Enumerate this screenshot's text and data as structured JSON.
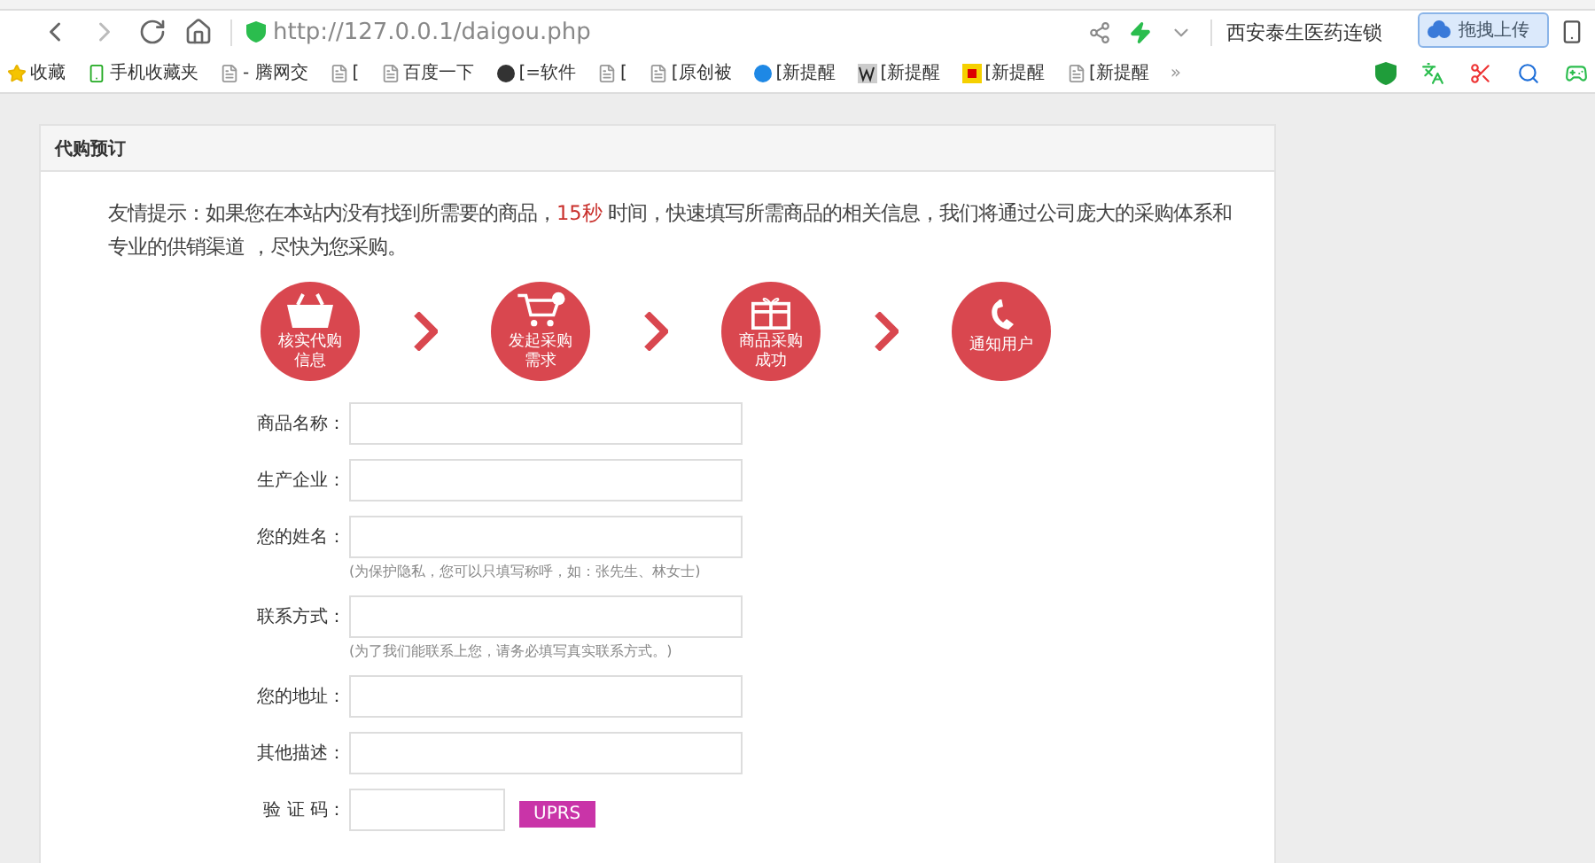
{
  "browser": {
    "url_host": "http://127.0.0.1/",
    "url_path": "daigou.php",
    "page_title": "西安泰生医药连锁",
    "upload_button": "拖拽上传",
    "bookmarks": [
      {
        "label": "收藏",
        "kind": "star"
      },
      {
        "label": "手机收藏夹",
        "kind": "phone"
      },
      {
        "label": "- 腾网交",
        "kind": "page"
      },
      {
        "label": "[",
        "kind": "page"
      },
      {
        "label": "百度一下",
        "kind": "page"
      },
      {
        "label": "[=软件",
        "kind": "disc"
      },
      {
        "label": "[",
        "kind": "page"
      },
      {
        "label": "[原创被",
        "kind": "page"
      },
      {
        "label": "[新提醒",
        "kind": "ie"
      },
      {
        "label": "[新提醒",
        "kind": "w"
      },
      {
        "label": "[新提醒",
        "kind": "gold"
      },
      {
        "label": "[新提醒",
        "kind": "page"
      }
    ],
    "more": "»"
  },
  "panel": {
    "title": "代购预订",
    "tip": {
      "before": "友情提示：如果您在本站内没有找到所需要的商品，",
      "highlight": "15秒",
      "after": " 时间，快速填写所需商品的相关信息，我们将通过公司庞大的采购体系和专业的供销渠道 ，尽快为您采购。"
    },
    "steps": [
      {
        "kind": "basket",
        "lines": [
          "核实代购",
          "信息"
        ]
      },
      {
        "kind": "cart",
        "lines": [
          "发起采购",
          "需求"
        ]
      },
      {
        "kind": "gift",
        "lines": [
          "商品采购",
          "成功"
        ]
      },
      {
        "kind": "phone",
        "lines": [
          "通知用户"
        ]
      }
    ],
    "fields": [
      {
        "kind": "text",
        "label": "商品名称："
      },
      {
        "kind": "text",
        "label": "生产企业："
      },
      {
        "kind": "text",
        "label": "您的姓名：",
        "hint": "(为保护隐私，您可以只填写称呼，如：张先生、林女士)"
      },
      {
        "kind": "text",
        "label": "联系方式：",
        "hint": "(为了我们能联系上您，请务必填写真实联系方式。)"
      },
      {
        "kind": "text",
        "label": "您的地址："
      },
      {
        "kind": "text",
        "label": "其他描述："
      },
      {
        "kind": "captcha",
        "label": "验 证 码：",
        "code": "UPRS"
      }
    ]
  }
}
